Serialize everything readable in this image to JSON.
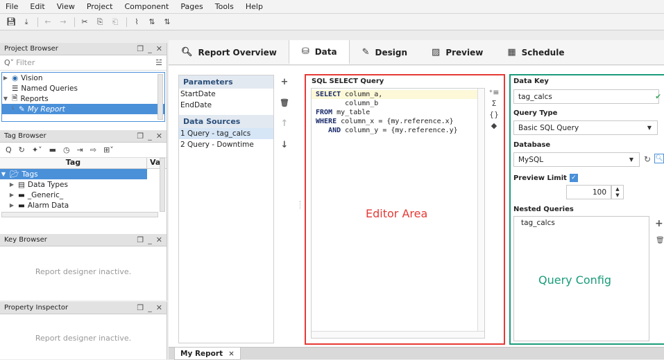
{
  "menu": [
    "File",
    "Edit",
    "View",
    "Project",
    "Component",
    "Pages",
    "Tools",
    "Help"
  ],
  "project_browser": {
    "title": "Project Browser",
    "filter_placeholder": "Filter",
    "items": [
      {
        "label": "Vision",
        "icon": "vision-icon"
      },
      {
        "label": "Named Queries",
        "icon": "named-queries-icon"
      },
      {
        "label": "Reports",
        "icon": "reports-icon"
      },
      {
        "label": "My Report",
        "icon": "report-icon",
        "selected": true
      }
    ]
  },
  "tag_browser": {
    "title": "Tag Browser",
    "col_tag": "Tag",
    "col_value": "Va",
    "items": [
      {
        "label": "Tags",
        "selected": true
      },
      {
        "label": "Data Types"
      },
      {
        "label": "_Generic_"
      },
      {
        "label": "Alarm Data"
      }
    ]
  },
  "key_browser": {
    "title": "Key Browser",
    "message": "Report designer inactive."
  },
  "property_inspector": {
    "title": "Property Inspector",
    "message": "Report designer inactive."
  },
  "tabs": [
    {
      "label": "Report Overview",
      "icon": "overview-icon",
      "active": false
    },
    {
      "label": "Data",
      "icon": "database-icon",
      "active": true
    },
    {
      "label": "Design",
      "icon": "design-icon",
      "active": false
    },
    {
      "label": "Preview",
      "icon": "preview-icon",
      "active": false
    },
    {
      "label": "Schedule",
      "icon": "calendar-icon",
      "active": false
    }
  ],
  "parameters": {
    "header": "Parameters",
    "items": [
      "StartDate",
      "EndDate"
    ]
  },
  "data_sources": {
    "header": "Data Sources",
    "items": [
      "1 Query - tag_calcs",
      "2 Query - Downtime"
    ],
    "selected_index": 0
  },
  "editor": {
    "label": "SQL SELECT Query",
    "lines": [
      {
        "kw": "SELECT",
        "rest": " column_a,"
      },
      {
        "kw": "",
        "rest": "       column_b"
      },
      {
        "kw": "FROM",
        "rest": " my_table"
      },
      {
        "kw": "WHERE",
        "rest": " column_x = {my.reference.x}"
      },
      {
        "kw": "   AND",
        "rest": " column_y = {my.reference.y}"
      }
    ],
    "overlay_label": "Editor Area"
  },
  "config": {
    "data_key_label": "Data Key",
    "data_key_value": "tag_calcs",
    "query_type_label": "Query Type",
    "query_type_value": "Basic SQL Query",
    "database_label": "Database",
    "database_value": "MySQL",
    "preview_limit_label": "Preview Limit",
    "preview_limit_checked": true,
    "preview_limit_value": "100",
    "nested_label": "Nested Queries",
    "nested_items": [
      "tag_calcs"
    ],
    "overlay_label": "Query Config"
  },
  "bottom_tab": {
    "label": "My Report",
    "close": "×"
  },
  "colors": {
    "editor_border": "#e53935",
    "config_border": "#1a9c7a",
    "selection": "#4a90d9"
  }
}
